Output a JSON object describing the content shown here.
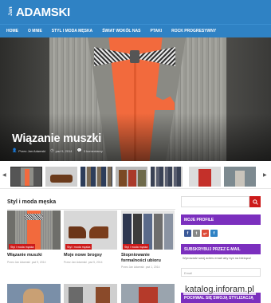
{
  "logo": {
    "first": "Jan",
    "last": "ADAMSKI"
  },
  "nav": [
    "HOME",
    "O MNIE",
    "STYL I MODA MĘSKA",
    "ŚWIAT WOKÓŁ NAS",
    "PTAKI",
    "ROCK PROGRESYWNY"
  ],
  "hero": {
    "title": "Wiązanie muszki",
    "author": "Przez Jan Adamski",
    "date": "paź 9, 2014",
    "comments": "3 komentarzy"
  },
  "section": {
    "title": "Styl i moda męska"
  },
  "cards": [
    {
      "category": "Styl i moda męska",
      "title": "Wiązanie muszki",
      "author": "Przez Jan Adamski",
      "date": "paź 9, 2014"
    },
    {
      "category": "Styl i moda męska",
      "title": "Moje nowe brogsy",
      "author": "Przez Jan Adamski",
      "date": "paź 5, 2014"
    },
    {
      "category": "Styl i moda męska",
      "title": "Stopniowanie formalności ubioru",
      "author": "Przez Jan Adamski",
      "date": "paź 1, 2014"
    }
  ],
  "sidebar": {
    "profile_title": "MOJE PROFILE",
    "social": [
      "f",
      "t",
      "g+",
      "f"
    ],
    "subscribe_title": "SUBSKRYBUJ PRZEZ E-MAIL",
    "subscribe_desc": "Wprowadź swój adres email aby być na bieżąco!",
    "email_placeholder": "Email",
    "next_title": "POCHWAL SIĘ SWOJĄ STYLIZACJĄ"
  },
  "watermark": "katalog.inforam.pl",
  "colors": {
    "brand_blue": "#2f82c4",
    "accent_red": "#cc1a1a",
    "widget_purple": "#7b2fbe"
  }
}
